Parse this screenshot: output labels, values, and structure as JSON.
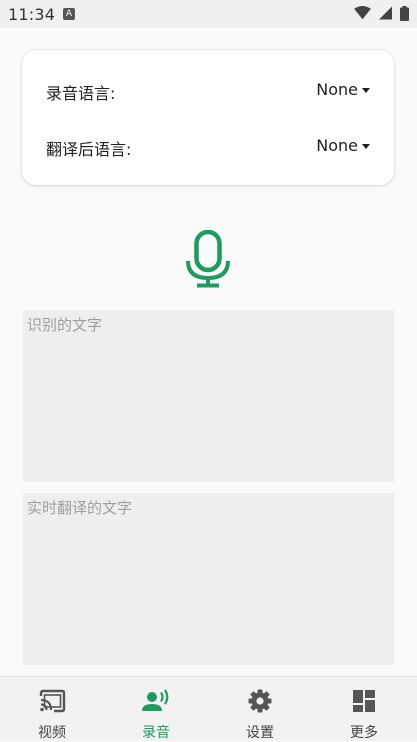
{
  "status_bar": {
    "time": "11:34",
    "notification_icon": "A"
  },
  "language_card": {
    "source_label": "录音语言:",
    "source_value": "None",
    "target_label": "翻译后语言:",
    "target_value": "None"
  },
  "mic": {
    "icon": "microphone-icon",
    "color": "#1e9b5e"
  },
  "recognized_text": {
    "placeholder": "识别的文字",
    "value": ""
  },
  "translated_text": {
    "placeholder": "实时翻译的文字",
    "value": ""
  },
  "bottom_nav": {
    "active_color": "#1e9b5e",
    "items": [
      {
        "label": "视频",
        "icon": "cast-icon",
        "active": false
      },
      {
        "label": "录音",
        "icon": "record-voice-icon",
        "active": true
      },
      {
        "label": "设置",
        "icon": "gear-icon",
        "active": false
      },
      {
        "label": "更多",
        "icon": "dashboard-icon",
        "active": false
      }
    ]
  }
}
